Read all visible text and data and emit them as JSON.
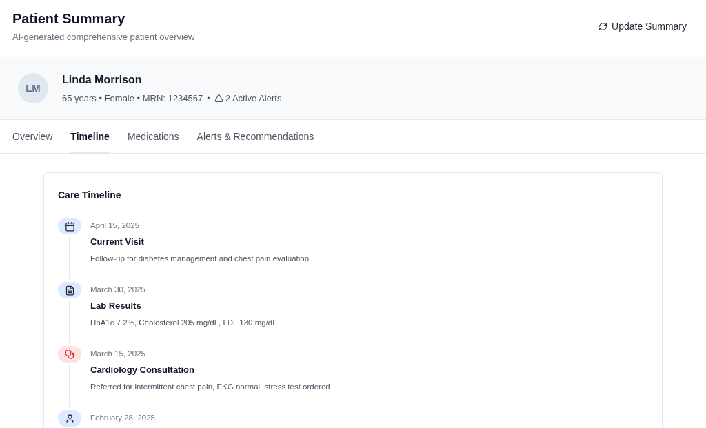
{
  "header": {
    "title": "Patient Summary",
    "subtitle": "AI-generated comprehensive patient overview",
    "update_button": "Update Summary"
  },
  "patient": {
    "initials": "LM",
    "name": "Linda Morrison",
    "details": "65 years • Female • MRN: 1234567",
    "separator": "•",
    "alerts": "2 Active Alerts"
  },
  "tabs": [
    {
      "label": "Overview",
      "selected": false
    },
    {
      "label": "Timeline",
      "selected": true
    },
    {
      "label": "Medications",
      "selected": false
    },
    {
      "label": "Alerts & Recommendations",
      "selected": false
    }
  ],
  "timeline": {
    "title": "Care Timeline",
    "events": [
      {
        "kind": "visit",
        "color": "#dbeafe",
        "date": "April 15, 2025",
        "title": "Current Visit",
        "description": "Follow-up for diabetes management and chest pain evaluation"
      },
      {
        "kind": "lab",
        "color": "#dbeafe",
        "date": "March 30, 2025",
        "title": "Lab Results",
        "description": "HbA1c 7.2%, Cholesterol 205 mg/dL, LDL 130 mg/dL"
      },
      {
        "kind": "consult",
        "color": "#fee2e2",
        "date": "March 15, 2025",
        "title": "Cardiology Consultation",
        "description": "Referred for intermittent chest pain, EKG normal, stress test ordered"
      },
      {
        "kind": "appointment",
        "color": "#dbeafe",
        "date": "February 28, 2025"
      }
    ]
  }
}
